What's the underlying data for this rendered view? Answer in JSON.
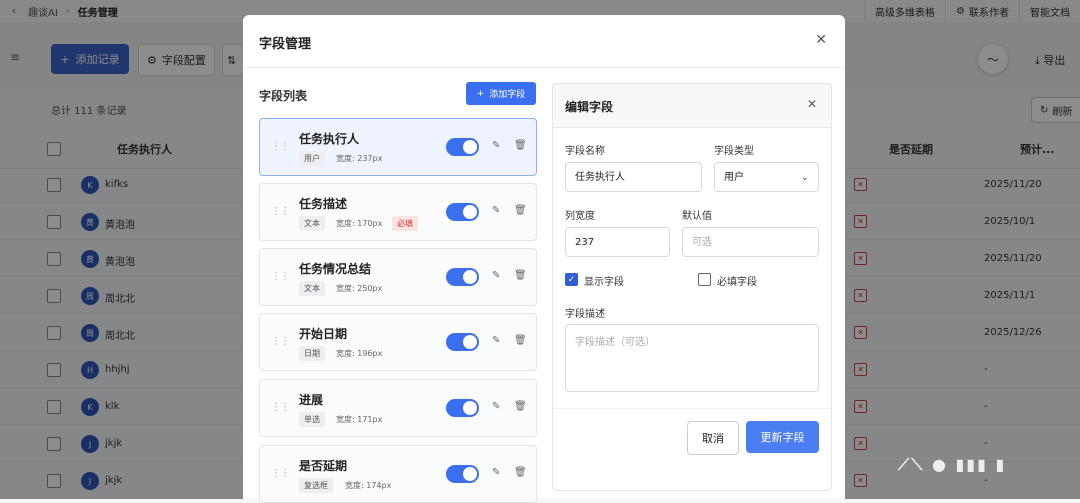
{
  "app": {
    "breadcrumb": [
      "趣谈AI",
      "任务管理"
    ],
    "top_actions": [
      "高级多维表格",
      "联系作者",
      "智能文档"
    ],
    "toolbar": {
      "add_record": "添加记录",
      "field_config": "字段配置",
      "export": "导出",
      "refresh": "刷新"
    },
    "total_label": "总计 111 条记录",
    "columns": [
      "任务执行人",
      "是否延期",
      "预计..."
    ],
    "rows": [
      {
        "initial": "K",
        "name": "kifks",
        "date": "2025/11/20"
      },
      {
        "initial": "黄",
        "name": "黄泡泡",
        "date": "2025/10/1"
      },
      {
        "initial": "黄",
        "name": "黄泡泡",
        "date": "2025/11/20"
      },
      {
        "initial": "周",
        "name": "周北北",
        "date": "2025/11/1"
      },
      {
        "initial": "周",
        "name": "周北北",
        "date": "2025/12/26"
      },
      {
        "initial": "H",
        "name": "hhjhj",
        "date": "-"
      },
      {
        "initial": "K",
        "name": "klk",
        "date": "-"
      },
      {
        "initial": "J",
        "name": "jkjk",
        "date": "-"
      },
      {
        "initial": "J",
        "name": "jkjk",
        "date": "-"
      }
    ]
  },
  "modal": {
    "title": "字段管理",
    "list_title": "字段列表",
    "add_field": "添加字段",
    "fields": [
      {
        "name": "任务执行人",
        "type": "用户",
        "width": "宽度: 237px",
        "required": ""
      },
      {
        "name": "任务描述",
        "type": "文本",
        "width": "宽度: 170px",
        "required": "必填"
      },
      {
        "name": "任务情况总结",
        "type": "文本",
        "width": "宽度: 250px",
        "required": ""
      },
      {
        "name": "开始日期",
        "type": "日期",
        "width": "宽度: 196px",
        "required": ""
      },
      {
        "name": "进展",
        "type": "单选",
        "width": "宽度: 171px",
        "required": ""
      },
      {
        "name": "是否延期",
        "type": "复选框",
        "width": "宽度: 174px",
        "required": ""
      }
    ],
    "edit": {
      "title": "编辑字段",
      "name_label": "字段名称",
      "name_value": "任务执行人",
      "type_label": "字段类型",
      "type_value": "用户",
      "width_label": "列宽度",
      "width_value": "237",
      "default_label": "默认值",
      "default_placeholder": "可选",
      "show_label": "显示字段",
      "required_label": "必填字段",
      "desc_label": "字段描述",
      "desc_placeholder": "字段描述（可选）",
      "cancel": "取消",
      "update": "更新字段"
    }
  },
  "colors": {
    "primary": "#3a6ff0",
    "required_tag": "#d33",
    "avatar": "#3156b8"
  }
}
